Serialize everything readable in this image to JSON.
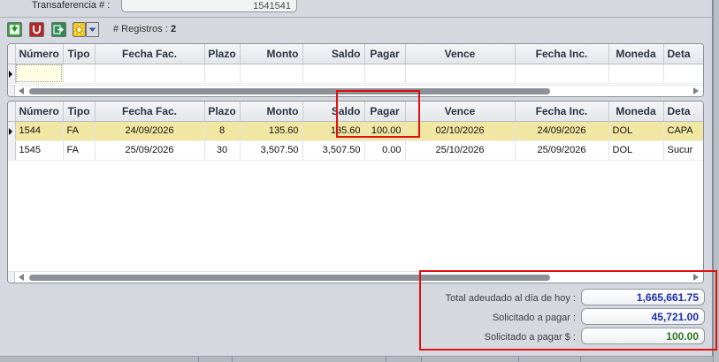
{
  "header": {
    "transfer_label": "Transaferencia # :",
    "transfer_value": "1541541"
  },
  "toolbar": {
    "buttons": [
      {
        "icon": "add-down-arrow-icon",
        "color": "#3aa03a"
      },
      {
        "icon": "magnet-undo-icon",
        "color": "#b62626"
      },
      {
        "icon": "exit-arrow-icon",
        "color": "#2e8b4e"
      },
      {
        "icon": "sun-lightbulb-icon",
        "color": "#f0c419"
      }
    ],
    "dropdown_icon": "chevron-down-icon",
    "registros_label": "# Registros :",
    "registros_count": "2"
  },
  "columns": [
    "Número",
    "Tipo",
    "Fecha Fac.",
    "Plazo",
    "Monto",
    "Saldo",
    "Pagar",
    "Vence",
    "Fecha Inc.",
    "Moneda",
    "Deta"
  ],
  "rows": [
    {
      "numero": "1544",
      "tipo": "FA",
      "fecha_fac": "24/09/2026",
      "plazo": "8",
      "monto": "135.60",
      "saldo": "135.60",
      "pagar": "100.00",
      "vence": "02/10/2026",
      "fecha_inc": "24/09/2026",
      "moneda": "DOL",
      "detalle": "CAPA"
    },
    {
      "numero": "1545",
      "tipo": "FA",
      "fecha_fac": "25/09/2026",
      "plazo": "30",
      "monto": "3,507.50",
      "saldo": "3,507.50",
      "pagar": "0.00",
      "vence": "25/10/2026",
      "fecha_inc": "25/09/2026",
      "moneda": "DOL",
      "detalle": "Sucur"
    }
  ],
  "summary": {
    "total_label": "Total adeudado al día de hoy :",
    "total_value": "1,665,661.75",
    "solicitado_label": "Solicitado a pagar :",
    "solicitado_value": "45,721.00",
    "solicitado_usd_label": "Solicitado a pagar $ :",
    "solicitado_usd_value": "100.00"
  },
  "colors": {
    "selected_row": "#f1e6a2",
    "value_blue": "#1f2fa8",
    "value_green": "#2f7a22",
    "highlight": "#e01010"
  }
}
